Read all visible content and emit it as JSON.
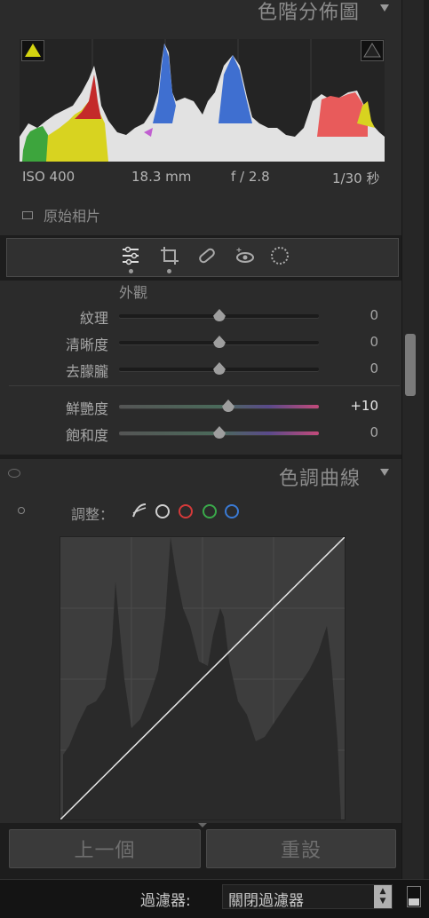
{
  "histogram": {
    "title": "色階分佈圖",
    "iso": "ISO 400",
    "focal": "18.3 mm",
    "aperture": "f / 2.8",
    "shutter": "1/30 秒",
    "original_photo_label": "原始相片"
  },
  "tools": [
    "edit-sliders-icon",
    "crop-icon",
    "healing-icon",
    "red-eye-icon",
    "mask-icon"
  ],
  "presence": {
    "section_label": "外觀",
    "sliders": [
      {
        "label": "紋理",
        "value": "0",
        "position": 0.5
      },
      {
        "label": "清晰度",
        "value": "0",
        "position": 0.5
      },
      {
        "label": "去朦朧",
        "value": "0",
        "position": 0.5
      },
      {
        "label": "鮮艷度",
        "value": "+10",
        "position": 0.55
      },
      {
        "label": "飽和度",
        "value": "0",
        "position": 0.5
      }
    ]
  },
  "tone_curve": {
    "title": "色調曲線",
    "adjust_label": "調整："
  },
  "buttons": {
    "previous": "上一個",
    "reset": "重設"
  },
  "filter": {
    "label": "過濾器:",
    "value": "關閉過濾器"
  },
  "colors": {
    "panel_bg": "#2b2b2b",
    "app_bg": "#1d1d1d",
    "curve_bg": "#3d3d3d"
  }
}
